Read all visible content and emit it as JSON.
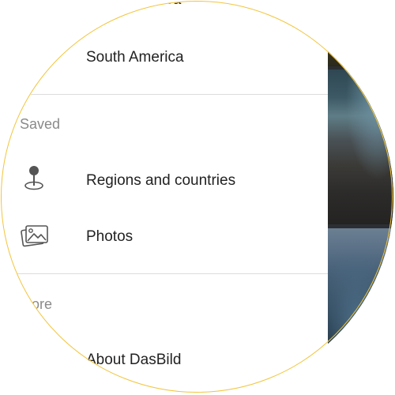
{
  "drawer": {
    "partial_top_label": "North America",
    "regions_item_label": "South America",
    "saved_header": "Saved",
    "saved_items": [
      {
        "label": "Regions and countries",
        "icon": "map-pin-icon"
      },
      {
        "label": "Photos",
        "icon": "photos-icon"
      }
    ],
    "more_header": "More",
    "more_items": [
      {
        "label": "About DasBild"
      }
    ]
  },
  "colors": {
    "ring": "#f2c53d",
    "text_primary": "#222222",
    "text_secondary": "#8a8a8a",
    "divider": "#dcdcdc"
  }
}
